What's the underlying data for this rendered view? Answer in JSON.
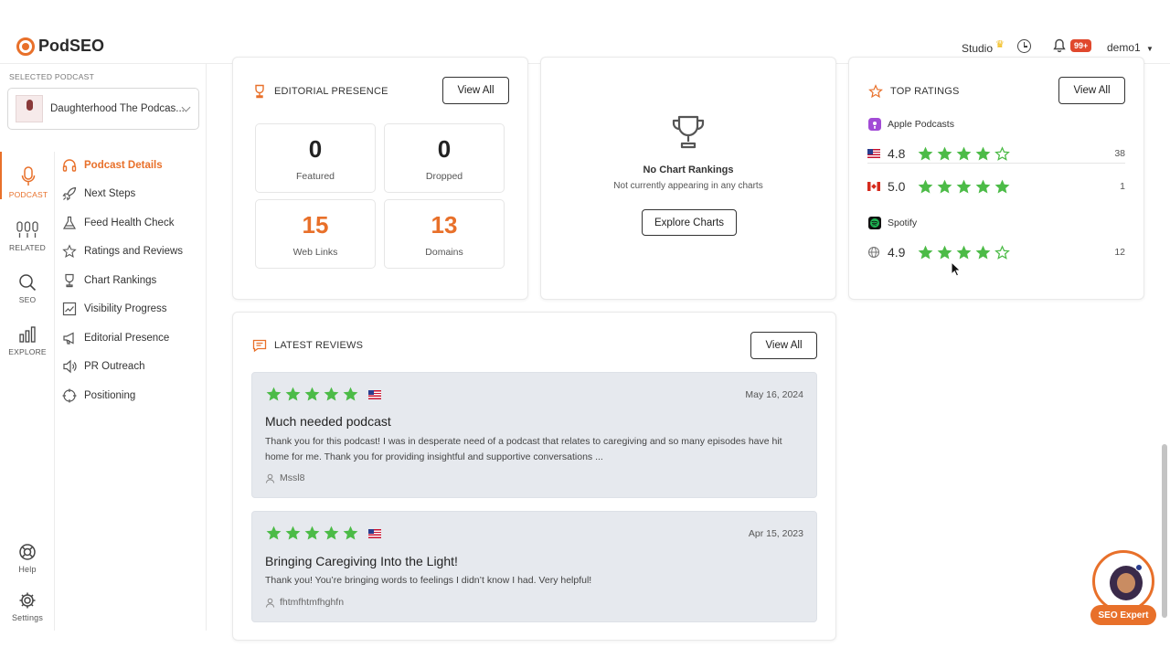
{
  "app": {
    "name": "PodSEO"
  },
  "header": {
    "studio_label": "Studio",
    "notification_count": "99+",
    "user_name": "demo1"
  },
  "sidebar": {
    "selected_label": "SELECTED PODCAST",
    "podcast_name": "Daughterhood The Podcas...",
    "rail": [
      {
        "label": "PODCAST",
        "icon": "microphone-icon",
        "active": true
      },
      {
        "label": "RELATED",
        "icon": "related-mics-icon",
        "active": false
      },
      {
        "label": "SEO",
        "icon": "search-icon",
        "active": false
      },
      {
        "label": "EXPLORE",
        "icon": "bar-chart-icon",
        "active": false
      }
    ],
    "help_label": "Help",
    "settings_label": "Settings",
    "nav": [
      {
        "label": "Podcast Details",
        "icon": "headphones-icon",
        "active": true
      },
      {
        "label": "Next Steps",
        "icon": "rocket-icon",
        "active": false
      },
      {
        "label": "Feed Health Check",
        "icon": "flask-icon",
        "active": false
      },
      {
        "label": "Ratings and Reviews",
        "icon": "star-icon",
        "active": false
      },
      {
        "label": "Chart Rankings",
        "icon": "trophy-icon",
        "active": false
      },
      {
        "label": "Visibility Progress",
        "icon": "trend-chart-icon",
        "active": false
      },
      {
        "label": "Editorial Presence",
        "icon": "megaphone-icon",
        "active": false
      },
      {
        "label": "PR Outreach",
        "icon": "speaker-icon",
        "active": false
      },
      {
        "label": "Positioning",
        "icon": "crosshair-icon",
        "active": false
      }
    ]
  },
  "editorial": {
    "title": "EDITORIAL PRESENCE",
    "view_all": "View All",
    "stats": [
      {
        "value": "0",
        "label": "Featured",
        "accent": false
      },
      {
        "value": "0",
        "label": "Dropped",
        "accent": false
      },
      {
        "value": "15",
        "label": "Web Links",
        "accent": true
      },
      {
        "value": "13",
        "label": "Domains",
        "accent": true
      }
    ]
  },
  "chart_rankings": {
    "title": "No Chart Rankings",
    "subtitle": "Not currently appearing in any charts",
    "button": "Explore Charts"
  },
  "top_ratings": {
    "title": "TOP RATINGS",
    "view_all": "View All",
    "apple_label": "Apple Podcasts",
    "spotify_label": "Spotify",
    "rows": [
      {
        "country": "us",
        "rating": "4.8",
        "stars": 4,
        "count": "38"
      },
      {
        "country": "ca",
        "rating": "5.0",
        "stars": 5,
        "count": "1"
      },
      {
        "country": "global",
        "rating": "4.9",
        "stars": 4,
        "count": "12"
      }
    ]
  },
  "latest_reviews": {
    "title": "LATEST REVIEWS",
    "view_all": "View All",
    "items": [
      {
        "stars": 5,
        "date": "May 16, 2024",
        "title": "Much needed podcast",
        "body": "Thank you for this podcast! I was in desperate need of a podcast that relates to caregiving and so many episodes have hit home for me. Thank you for providing insightful and supportive conversations ...",
        "author": "Mssl8"
      },
      {
        "stars": 5,
        "date": "Apr 15, 2023",
        "title": "Bringing Caregiving Into the Light!",
        "body": "Thank you! You’re bringing words to feelings I didn’t know I had. Very helpful!",
        "author": "fhtmfhtmfhghfn"
      }
    ]
  },
  "assistant": {
    "label": "SEO Expert"
  },
  "colors": {
    "accent": "#e8702a",
    "star_green": "#4cbb47",
    "badge_red": "#e0482d"
  }
}
